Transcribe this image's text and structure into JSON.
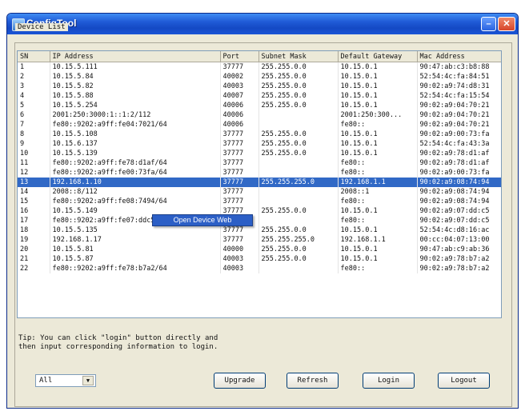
{
  "window": {
    "title": "ConfigTool"
  },
  "device_list": {
    "label": "Device List",
    "columns": [
      "SN",
      "IP Address",
      "Port",
      "Subnet Mask",
      "Default Gateway",
      "Mac Address"
    ],
    "rows": [
      [
        "1",
        "10.15.5.111",
        "37777",
        "255.255.0.0",
        "10.15.0.1",
        "90:47:ab:c3:b8:88"
      ],
      [
        "2",
        "10.15.5.84",
        "40002",
        "255.255.0.0",
        "10.15.0.1",
        "52:54:4c:fa:84:51"
      ],
      [
        "3",
        "10.15.5.82",
        "40003",
        "255.255.0.0",
        "10.15.0.1",
        "90:02:a9:74:d8:31"
      ],
      [
        "4",
        "10.15.5.88",
        "40007",
        "255.255.0.0",
        "10.15.0.1",
        "52:54:4c:fa:15:54"
      ],
      [
        "5",
        "10.15.5.254",
        "40006",
        "255.255.0.0",
        "10.15.0.1",
        "90:02:a9:04:70:21"
      ],
      [
        "6",
        "2001:250:3000:1::1:2/112",
        "40006",
        "",
        "2001:250:300...",
        "90:02:a9:04:70:21"
      ],
      [
        "7",
        "fe80::9202:a9ff:fe04:7021/64",
        "40006",
        "",
        "fe80::",
        "90:02:a9:04:70:21"
      ],
      [
        "8",
        "10.15.5.108",
        "37777",
        "255.255.0.0",
        "10.15.0.1",
        "90:02:a9:00:73:fa"
      ],
      [
        "9",
        "10.15.6.137",
        "37777",
        "255.255.0.0",
        "10.15.0.1",
        "52:54:4c:fa:43:3a"
      ],
      [
        "10",
        "10.15.5.139",
        "37777",
        "255.255.0.0",
        "10.15.0.1",
        "90:02:a9:78:d1:af"
      ],
      [
        "11",
        "fe80::9202:a9ff:fe78:d1af/64",
        "37777",
        "",
        "fe80::",
        "90:02:a9:78:d1:af"
      ],
      [
        "12",
        "fe80::9202:a9ff:fe00:73fa/64",
        "37777",
        "",
        "fe80::",
        "90:02:a9:00:73:fa"
      ],
      [
        "13",
        "192.168.1.10",
        "37777",
        "255.255.255.0",
        "192.168.1.1",
        "90:02:a9:08:74:94"
      ],
      [
        "14",
        "2008::8/112",
        "37777",
        "",
        "2008::1",
        "90:02:a9:08:74:94"
      ],
      [
        "15",
        "fe80::9202:a9ff:fe08:7494/64",
        "37777",
        "",
        "fe80::",
        "90:02:a9:08:74:94"
      ],
      [
        "16",
        "10.15.5.149",
        "37777",
        "255.255.0.0",
        "10.15.0.1",
        "90:02:a9:07:dd:c5"
      ],
      [
        "17",
        "fe80::9202:a9ff:fe07:ddc5/64",
        "37777",
        "",
        "fe80::",
        "90:02:a9:07:dd:c5"
      ],
      [
        "18",
        "10.15.5.135",
        "37777",
        "255.255.0.0",
        "10.15.0.1",
        "52:54:4c:d8:16:ac"
      ],
      [
        "19",
        "192.168.1.17",
        "37777",
        "255.255.255.0",
        "192.168.1.1",
        "00:cc:04:07:13:00"
      ],
      [
        "20",
        "10.15.5.81",
        "40000",
        "255.255.0.0",
        "10.15.0.1",
        "90:47:ab:c9:ab:36"
      ],
      [
        "21",
        "10.15.5.87",
        "40003",
        "255.255.0.0",
        "10.15.0.1",
        "90:02:a9:78:b7:a2"
      ],
      [
        "22",
        "fe80::9202:a9ff:fe78:b7a2/64",
        "40003",
        "",
        "fe80::",
        "90:02:a9:78:b7:a2"
      ]
    ],
    "selected_row": 13
  },
  "context_menu": {
    "item": "Open Device Web"
  },
  "tip": {
    "line1": "Tip: You can click \"login\" button directly and",
    "line2": "then input corresponding information to login."
  },
  "filter": {
    "value": "All"
  },
  "buttons": {
    "upgrade": "Upgrade",
    "refresh": "Refresh",
    "login": "Login",
    "logout": "Logout"
  }
}
